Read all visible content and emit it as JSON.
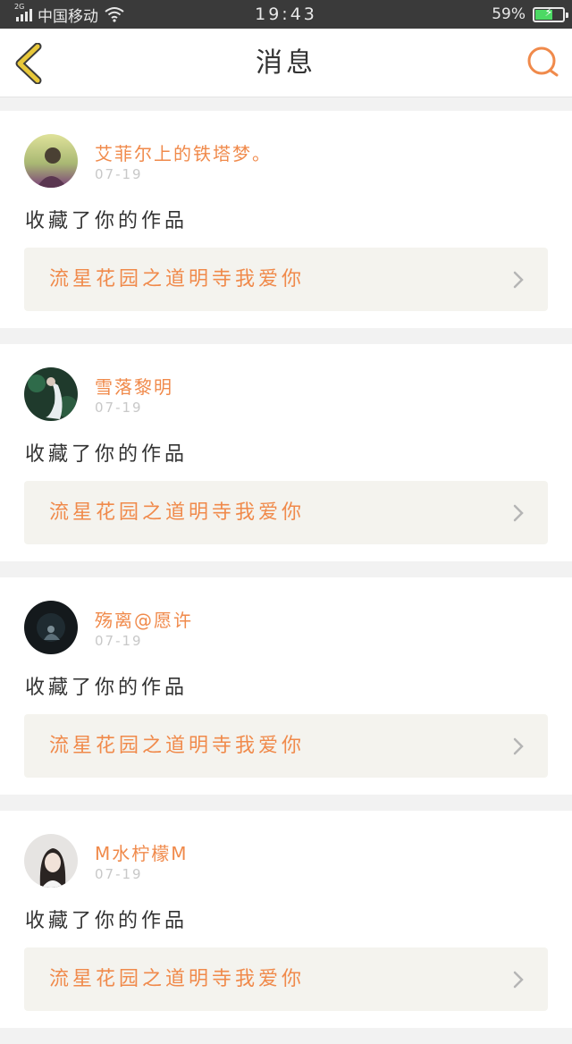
{
  "status_bar": {
    "network_type": "2G",
    "carrier": "中国移动",
    "time": "19:43",
    "battery_percent": "59%",
    "battery_level": 0.59,
    "icons": [
      "signal-icon",
      "wifi-icon",
      "battery-charging-icon"
    ]
  },
  "nav": {
    "title": "消息",
    "back_icon": "back-chevron-icon",
    "search_icon": "search-icon",
    "accent_color": "#f08a4b",
    "back_color": "#e8c83a"
  },
  "messages": [
    {
      "username": "艾菲尔上的铁塔梦。",
      "date": "07-19",
      "action": "收藏了你的作品",
      "work_title": "流星花园之道明寺我爱你"
    },
    {
      "username": "雪落黎明",
      "date": "07-19",
      "action": "收藏了你的作品",
      "work_title": "流星花园之道明寺我爱你"
    },
    {
      "username": "殇离@愿许",
      "date": "07-19",
      "action": "收藏了你的作品",
      "work_title": "流星花园之道明寺我爱你"
    },
    {
      "username": "M水柠檬M",
      "date": "07-19",
      "action": "收藏了你的作品",
      "work_title": "流星花园之道明寺我爱你"
    }
  ]
}
